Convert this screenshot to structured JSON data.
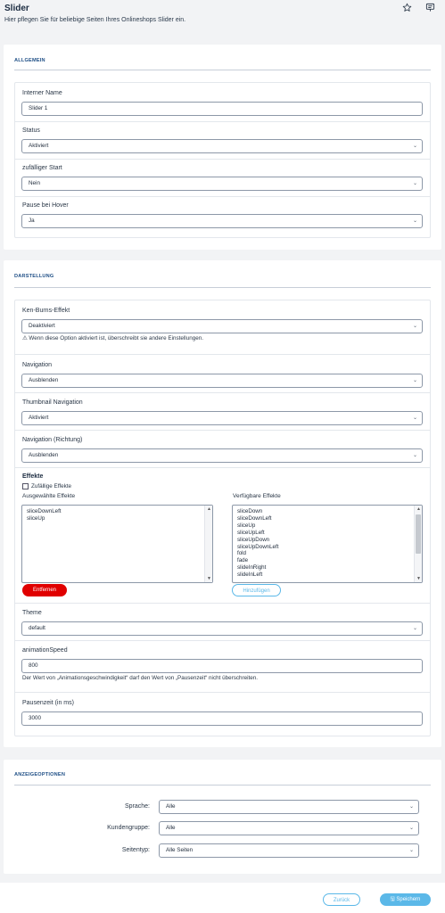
{
  "header": {
    "title": "Slider",
    "subtitle": "Hier pflegen Sie für beliebige Seiten Ihres Onlineshops Slider ein.",
    "star_icon": "star-icon",
    "sidebar_icon": "sidebar-icon"
  },
  "general": {
    "title": "ALLGEMEIN",
    "internal_name_label": "Interner Name",
    "internal_name_value": "Slider 1",
    "status_label": "Status",
    "status_value": "Aktiviert",
    "random_start_label": "zufälliger Start",
    "random_start_value": "Nein",
    "pause_hover_label": "Pause bei Hover",
    "pause_hover_value": "Ja"
  },
  "display": {
    "title": "DARSTELLUNG",
    "ken_burns_label": "Ken-Burns-Effekt",
    "ken_burns_value": "Deaktiviert",
    "ken_burns_warning": "Wenn diese Option aktiviert ist, überschreibt sie andere Einstellungen.",
    "navigation_label": "Navigation",
    "navigation_value": "Ausblenden",
    "thumb_nav_label": "Thumbnail Navigation",
    "thumb_nav_value": "Aktiviert",
    "nav_direction_label": "Navigation (Richtung)",
    "nav_direction_value": "Ausblenden",
    "effects_heading": "Effekte",
    "random_effects_label": "Zufällige Effekte",
    "selected_effects_label": "Ausgewählte Effekte",
    "available_effects_label": "Verfügbare Effekte",
    "selected_effects": [
      "sliceDownLeft",
      "sliceUp"
    ],
    "available_effects": [
      "sliceDown",
      "sliceDownLeft",
      "sliceUp",
      "sliceUpLeft",
      "sliceUpDown",
      "sliceUpDownLeft",
      "fold",
      "fade",
      "slideInRight",
      "slideInLeft"
    ],
    "remove_button": "Entfernen",
    "add_button": "Hinzufügen",
    "theme_label": "Theme",
    "theme_value": "default",
    "anim_speed_label": "animationSpeed",
    "anim_speed_value": "800",
    "anim_speed_note": "Der Wert von „Animationsgeschwindigkeit“ darf den Wert von „Pausenzeit“ nicht überschreiten.",
    "pause_time_label": "Pausenzeit (in ms)",
    "pause_time_value": "3000"
  },
  "display_options": {
    "title": "ANZEIGEOPTIONEN",
    "language_label": "Sprache:",
    "language_value": "Alle",
    "customer_group_label": "Kundengruppe:",
    "customer_group_value": "Alle",
    "page_type_label": "Seitentyp:",
    "page_type_value": "Alle Seiten"
  },
  "footer": {
    "back_button": "Zurück",
    "save_button": "Speichern"
  },
  "colors": {
    "accent": "#1f4f86",
    "danger": "#e00000",
    "info": "#5bb8e8"
  }
}
